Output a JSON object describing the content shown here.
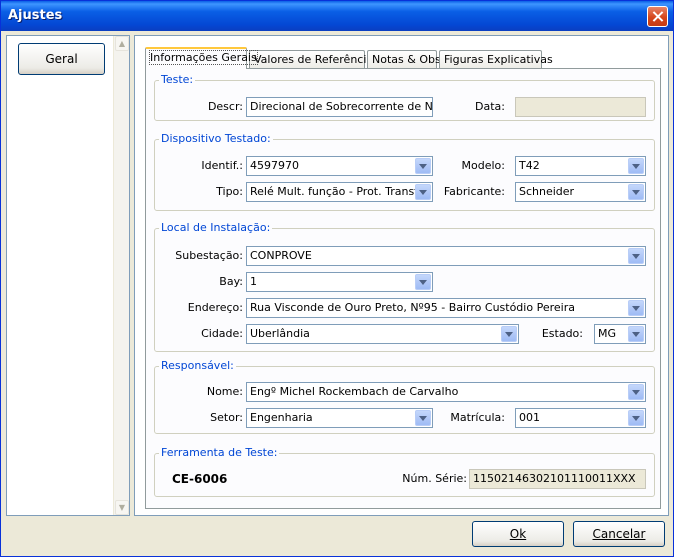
{
  "window": {
    "title": "Ajustes"
  },
  "left_panel": {
    "geral_label": "Geral"
  },
  "tabs": [
    {
      "label": "Informações Gerais"
    },
    {
      "label": "Valores de Referência"
    },
    {
      "label": "Notas & Obs."
    },
    {
      "label": "Figuras Explicativas"
    }
  ],
  "teste": {
    "legend": "Teste:",
    "descr_label": "Descr:",
    "descr_value": "Direcional de Sobrecorrente de Neutr",
    "data_label": "Data:",
    "data_value": ""
  },
  "dispositivo": {
    "legend": "Dispositivo Testado:",
    "identif_label": "Identif.:",
    "identif_value": "4597970",
    "modelo_label": "Modelo:",
    "modelo_value": "T42",
    "tipo_label": "Tipo:",
    "tipo_value": "Relé Mult. função - Prot. Transfor",
    "fabricante_label": "Fabricante:",
    "fabricante_value": "Schneider"
  },
  "local": {
    "legend": "Local de Instalação:",
    "subestacao_label": "Subestação:",
    "subestacao_value": "CONPROVE",
    "bay_label": "Bay:",
    "bay_value": "1",
    "endereco_label": "Endereço:",
    "endereco_value": "Rua Visconde de Ouro Preto, Nº95 - Bairro Custódio Pereira",
    "cidade_label": "Cidade:",
    "cidade_value": "Uberlândia",
    "estado_label": "Estado:",
    "estado_value": "MG"
  },
  "responsavel": {
    "legend": "Responsável:",
    "nome_label": "Nome:",
    "nome_value": "Engº Michel Rockembach de Carvalho",
    "setor_label": "Setor:",
    "setor_value": "Engenharia",
    "matricula_label": "Matrícula:",
    "matricula_value": "001"
  },
  "ferramenta": {
    "legend": "Ferramenta de Teste:",
    "model": "CE-6006",
    "serie_label": "Núm. Série:",
    "serie_value": "11502146302101110011XXX"
  },
  "buttons": {
    "ok": "Ok",
    "cancel": "Cancelar"
  }
}
